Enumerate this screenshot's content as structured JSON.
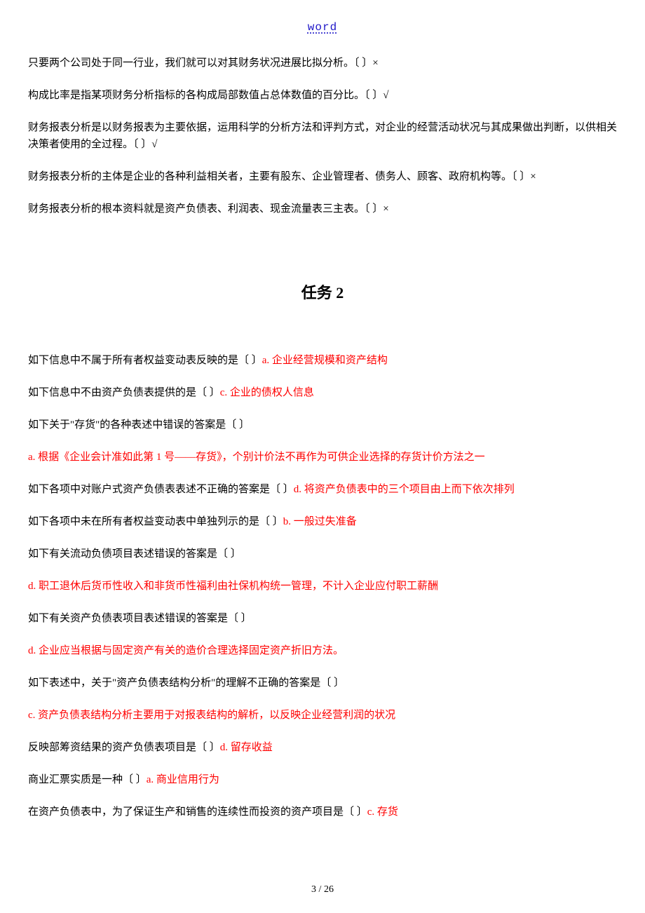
{
  "header": {
    "label": "word"
  },
  "tf": {
    "q1": "只要两个公司处于同一行业，我们就可以对其财务状况进展比拟分析。〔  〕×",
    "q2": "构成比率是指某项财务分析指标的各构成局部数值占总体数值的百分比。〔  〕√",
    "q3": "财务报表分析是以财务报表为主要依据，运用科学的分析方法和评判方式，对企业的经营活动状况与其成果做出判断，以供相关决策者使用的全过程。〔  〕√",
    "q4": "财务报表分析的主体是企业的各种利益相关者，主要有股东、企业管理者、债务人、顾客、政府机构等。〔  〕×",
    "q5": "财务报表分析的根本资料就是资产负债表、利润表、现金流量表三主表。〔  〕×"
  },
  "section_title": "任务 2",
  "mc": {
    "q1": {
      "stem": "如下信息中不属于所有者权益变动表反映的是〔  〕",
      "ans": "a.  企业经营规模和资产结构"
    },
    "q2": {
      "stem": "如下信息中不由资产负债表提供的是〔    〕",
      "ans": "c.  企业的债权人信息"
    },
    "q3": {
      "stem": "如下关于\"存货\"的各种表述中错误的答案是〔    〕"
    },
    "q3a": "a.  根据《企业会计准如此第 1 号——存货》，个别计价法不再作为可供企业选择的存货计价方法之一",
    "q4": {
      "stem": "如下各项中对账户式资产负债表表述不正确的答案是〔  〕",
      "ans": "d.  将资产负债表中的三个项目由上而下依次排列"
    },
    "q5": {
      "stem": "如下各项中未在所有者权益变动表中单独列示的是〔    〕",
      "ans": "b.  一般过失准备"
    },
    "q6": {
      "stem": "如下有关流动负债项目表述错误的答案是〔    〕"
    },
    "q6a": "d.  职工退休后货币性收入和非货币性福利由社保机构统一管理，不计入企业应付职工薪酬",
    "q7": {
      "stem": "如下有关资产负债表项目表述错误的答案是〔  〕"
    },
    "q7a": "d.  企业应当根据与固定资产有关的造价合理选择固定资产折旧方法。",
    "q8": {
      "stem": "如下表述中，关于\"资产负债表结构分析\"的理解不正确的答案是〔    〕"
    },
    "q8a": "c.  资产负债表结构分析主要用于对报表结构的解析，以反映企业经营利润的状况",
    "q9": {
      "stem": "反映部筹资结果的资产负债表项目是〔    〕",
      "ans": "d.  留存收益"
    },
    "q10": {
      "stem": "商业汇票实质是一种〔    〕",
      "ans": "a.  商业信用行为"
    },
    "q11": {
      "stem": "在资产负债表中，为了保证生产和销售的连续性而投资的资产项目是〔  〕",
      "ans": "c.  存货"
    }
  },
  "footer": {
    "page": "3",
    "sep": " / ",
    "total": "26"
  }
}
